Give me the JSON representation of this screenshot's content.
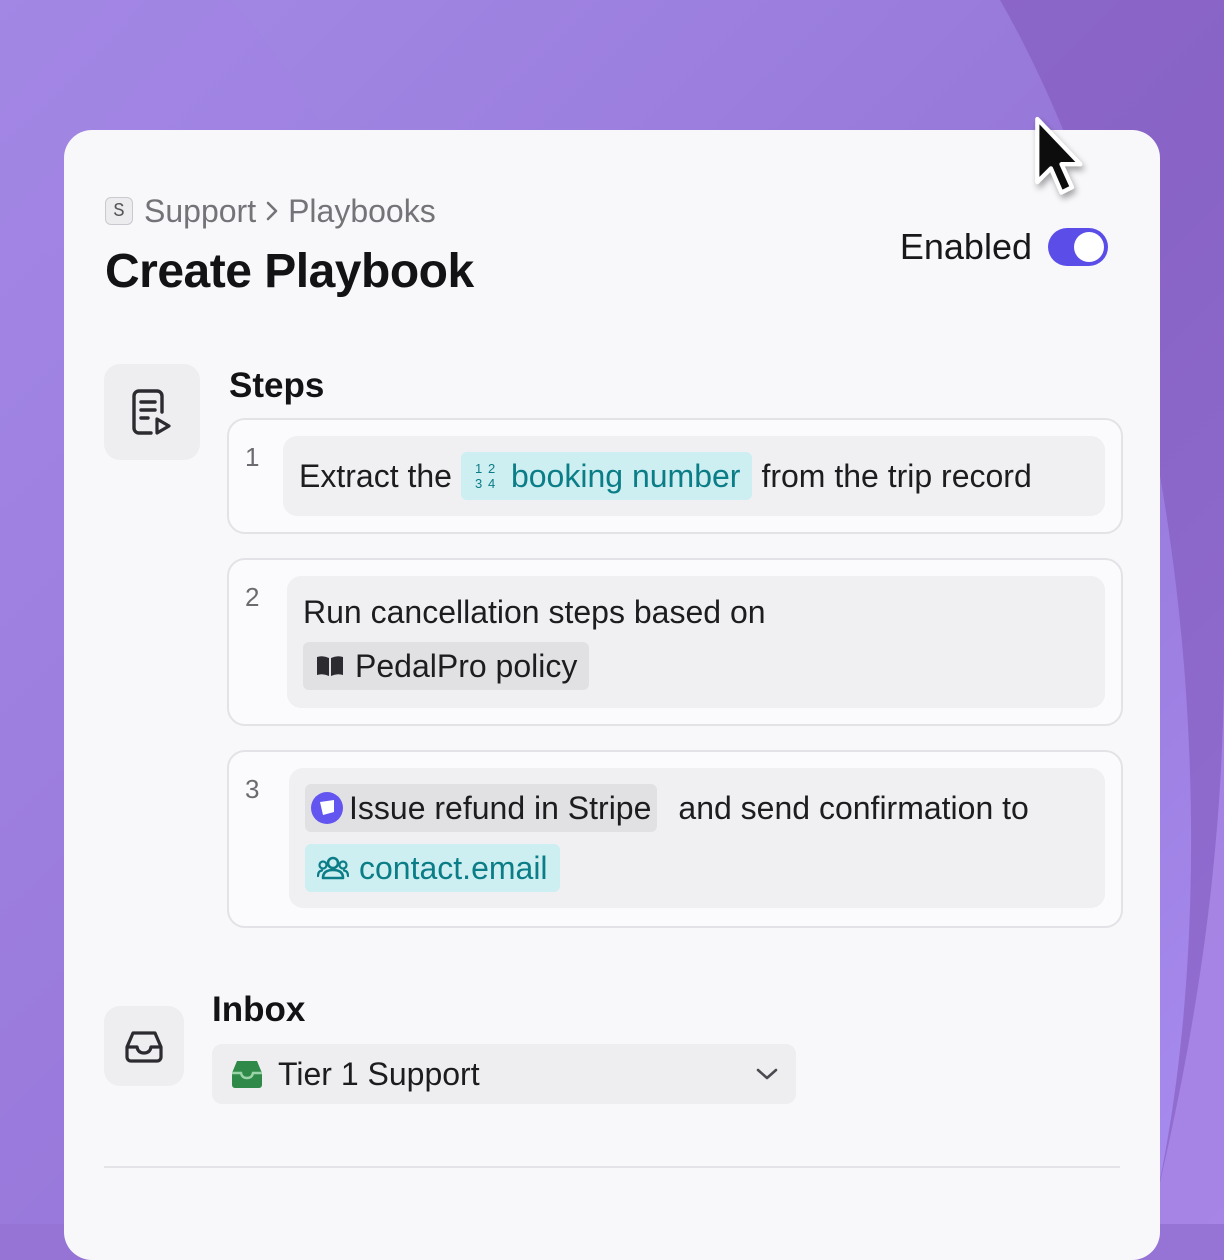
{
  "breadcrumb": {
    "workspace_badge": "S",
    "items": [
      "Support",
      "Playbooks"
    ]
  },
  "page": {
    "title": "Create Playbook"
  },
  "toggle": {
    "label": "Enabled",
    "on": true,
    "accent": "#5b4ee8"
  },
  "steps_section": {
    "title": "Steps",
    "steps": [
      {
        "number": "1",
        "text_before": "Extract the",
        "chip_label": "booking number",
        "chip_icon": "numbers-icon",
        "chip_icon_digits": [
          "1",
          "2",
          "3",
          "4"
        ],
        "text_after": "from the trip record"
      },
      {
        "number": "2",
        "text_before": "Run cancellation steps based on",
        "chip_label": "PedalPro policy",
        "chip_icon": "book-icon"
      },
      {
        "number": "3",
        "chip_label": "Issue refund in Stripe",
        "chip_icon": "stripe-icon",
        "text_after": "and send confirmation to",
        "chip2_label": "contact.email",
        "chip2_icon": "users-icon"
      }
    ]
  },
  "inbox_section": {
    "title": "Inbox",
    "selected": "Tier 1 Support",
    "selected_icon": "inbox-green-icon"
  },
  "colors": {
    "background": "#9574d6",
    "teal_chip": "#cdeff2",
    "teal_text": "#0b7d87",
    "inbox_green": "#2f8a4a"
  }
}
